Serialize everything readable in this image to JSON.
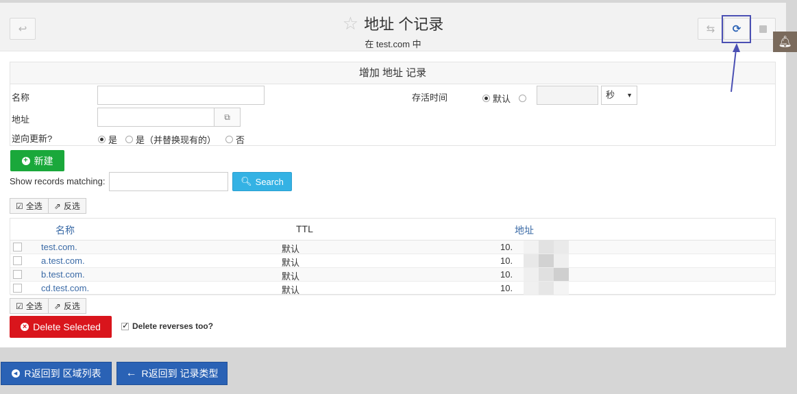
{
  "header": {
    "title": "地址 个记录",
    "subtitle": "在 test.com 中"
  },
  "form": {
    "heading": "增加 地址 记录",
    "name_label": "名称",
    "address_label": "地址",
    "reverse_label": "逆向更新?",
    "ttl_label": "存活时间",
    "ttl_default_label": "默认",
    "ttl_unit": "秒",
    "reverse_options": [
      "是",
      "是（并替换现有的）",
      "否"
    ]
  },
  "create_label": "新建",
  "search": {
    "label": "Show records matching:",
    "button": "Search"
  },
  "selection": {
    "select_all": "全选",
    "invert": "反选"
  },
  "table": {
    "columns": [
      "名称",
      "TTL",
      "地址"
    ],
    "rows": [
      {
        "name": "test.com.",
        "ttl": "默认",
        "address": "10."
      },
      {
        "name": "a.test.com.",
        "ttl": "默认",
        "address": "10."
      },
      {
        "name": "b.test.com.",
        "ttl": "默认",
        "address": "10."
      },
      {
        "name": "cd.test.com.",
        "ttl": "默认",
        "address": "10."
      }
    ]
  },
  "delete": {
    "button": "Delete Selected",
    "reverses_label": "Delete reverses too?"
  },
  "footer": {
    "back_zone_list": "R返回到 区域列表",
    "back_record_types": "R返回到 记录类型"
  },
  "colors": {
    "green": "#1aa83b",
    "red": "#d9151c",
    "blue": "#2a62b5",
    "search": "#34b2e4",
    "highlight": "#4a4fb3"
  }
}
